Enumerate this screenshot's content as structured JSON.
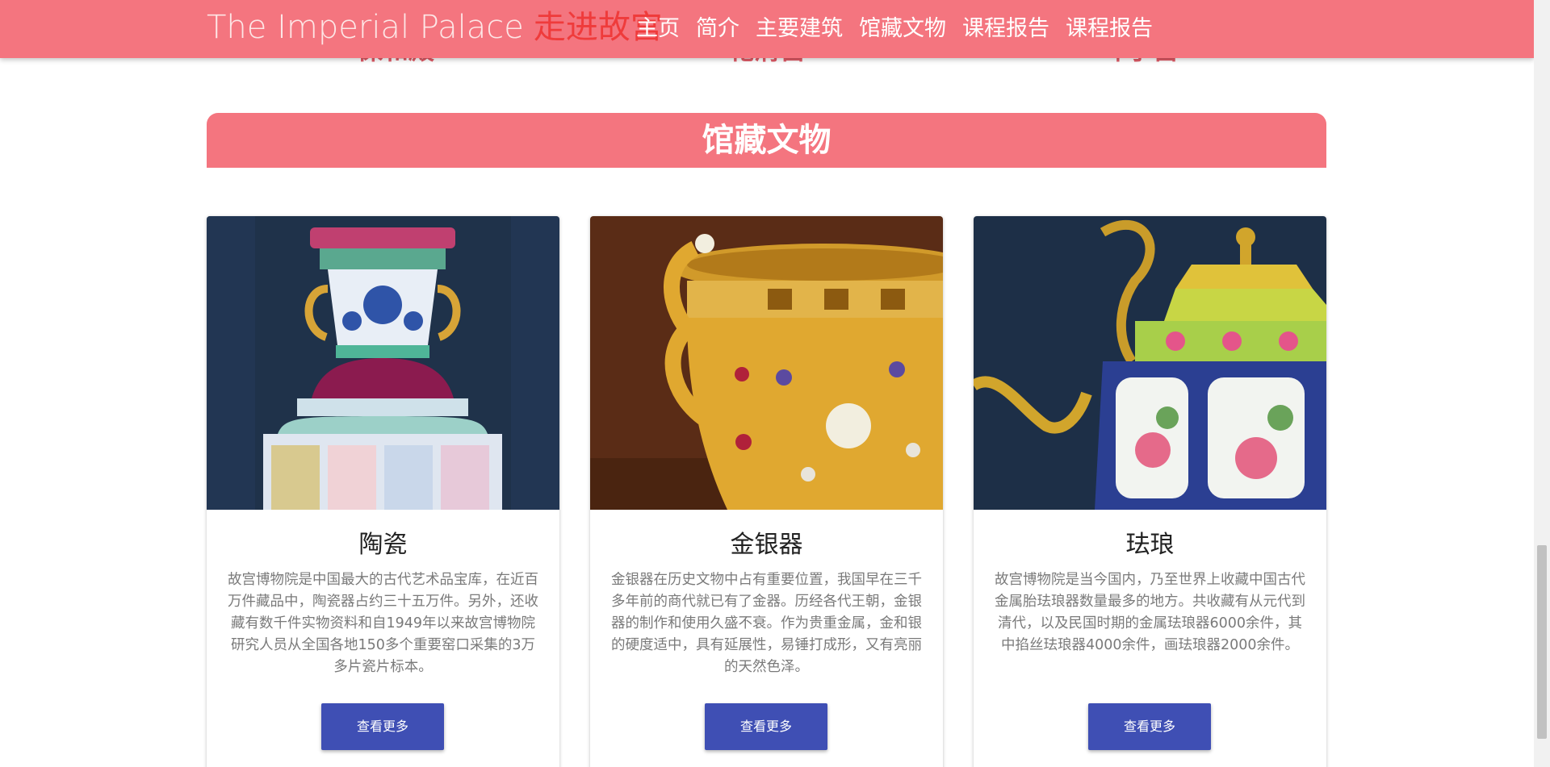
{
  "navbar": {
    "brand_en": "The Imperial Palace",
    "brand_cn": "走进故宫",
    "links": [
      "主页",
      "简介",
      "主要建筑",
      "馆藏文物",
      "课程报告",
      "课程报告"
    ]
  },
  "previous_section": {
    "labels": [
      "保和殿",
      "乾清宫",
      "坤宁宫"
    ]
  },
  "section": {
    "title": "馆藏文物"
  },
  "cards": [
    {
      "title": "陶瓷",
      "description": "故宫博物院是中国最大的古代艺术品宝库，在近百万件藏品中，陶瓷器占约三十五万件。另外，还收藏有数千件实物资料和自1949年以来故宫博物院研究人员从全国各地150多个重要窑口采集的3万多片瓷片标本。",
      "button": "查看更多",
      "image": "porcelain-vase"
    },
    {
      "title": "金银器",
      "description": "金银器在历史文物中占有重要位置，我国早在三千多年前的商代就已有了金器。历经各代王朝，金银器的制作和使用久盛不衰。作为贵重金属，金和银的硬度适中，具有延展性，易锤打成形，又有亮丽的天然色泽。",
      "button": "查看更多",
      "image": "gold-cup"
    },
    {
      "title": "珐琅",
      "description": "故宫博物院是当今国内，乃至世界上收藏中国古代金属胎珐琅器数量最多的地方。共收藏有从元代到清代，以及民国时期的金属珐琅器6000余件，其中掐丝珐琅器4000余件，画珐琅器2000余件。",
      "button": "查看更多",
      "image": "enamel-teapot"
    }
  ],
  "colors": {
    "primary": "#f4757f",
    "brand_cn": "#ef3b3b",
    "button": "#3f4fb4"
  }
}
